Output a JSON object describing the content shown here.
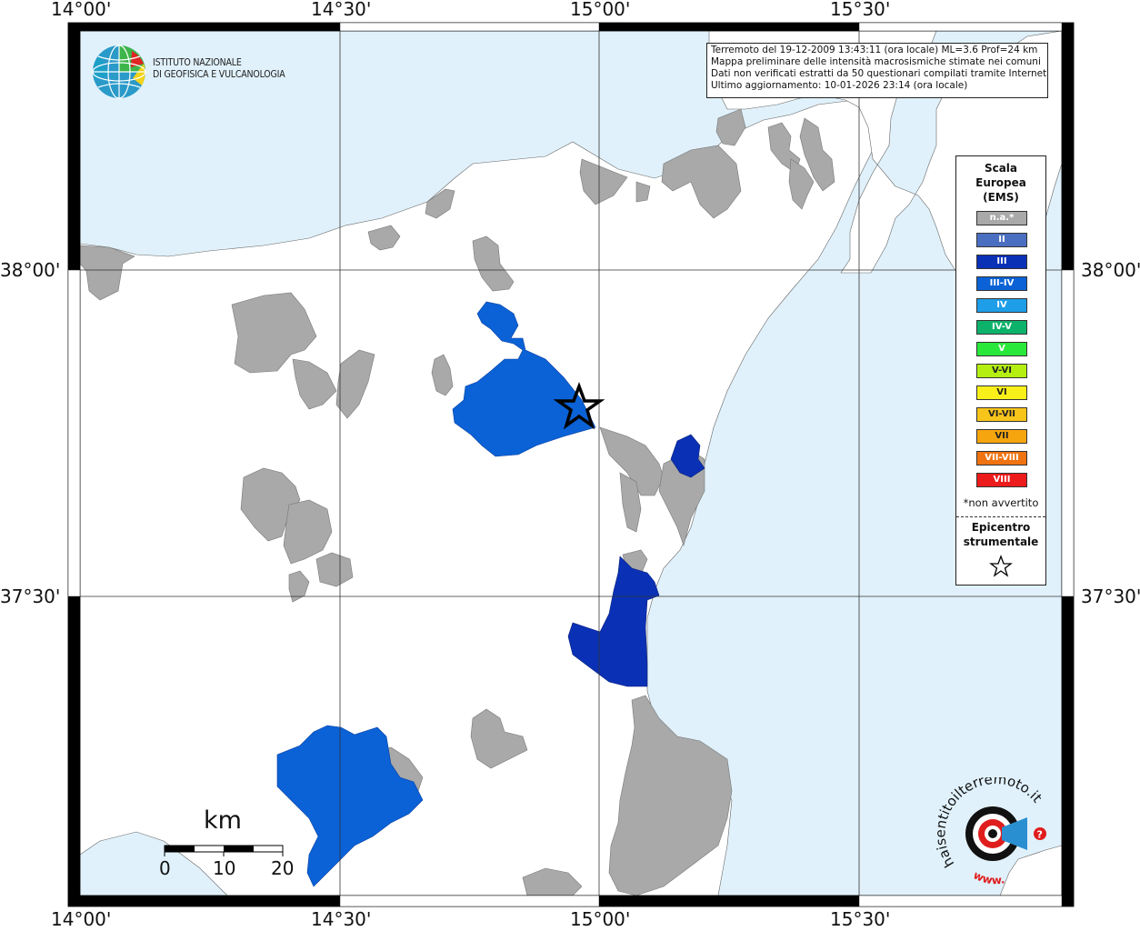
{
  "map": {
    "lon_ticks": [
      "14°00'",
      "14°30'",
      "15°00'",
      "15°30'"
    ],
    "lat_ticks": [
      "38°00'",
      "37°30'"
    ]
  },
  "info": {
    "line1": "Terremoto del 19-12-2009 13:43:11 (ora locale) ML=3.6 Prof=24 km",
    "line2": "Mappa preliminare delle intensità macrosismiche stimate nei comuni",
    "line3": "Dati non verificati estratti da 50 questionari compilati tramite Internet.",
    "line4": "Ultimo aggiornamento: 10-01-2026 23:14 (ora locale)"
  },
  "ingv": {
    "line1": "ISTITUTO NAZIONALE",
    "line2": "DI GEOFISICA E VULCANOLOGIA"
  },
  "legend": {
    "title1": "Scala",
    "title2": "Europea",
    "title3": "(EMS)",
    "items": [
      {
        "label": "n.a.*",
        "color": "#a9a9a9"
      },
      {
        "label": "II",
        "color": "#4a6fc0"
      },
      {
        "label": "III",
        "color": "#0a31b5"
      },
      {
        "label": "III-IV",
        "color": "#0a62d6"
      },
      {
        "label": "IV",
        "color": "#1e9ee8"
      },
      {
        "label": "IV-V",
        "color": "#0db26a"
      },
      {
        "label": "V",
        "color": "#29e83a"
      },
      {
        "label": "V-VI",
        "color": "#b5ef12"
      },
      {
        "label": "VI",
        "color": "#f9f01a"
      },
      {
        "label": "VI-VII",
        "color": "#f7c51a"
      },
      {
        "label": "VII",
        "color": "#f7a50f"
      },
      {
        "label": "VII-VIII",
        "color": "#ef7310"
      },
      {
        "label": "VIII",
        "color": "#ec1c1c"
      }
    ],
    "note": "*non avvertito",
    "epi1": "Epicentro",
    "epi2": "strumentale"
  },
  "scale": {
    "unit": "km",
    "labels": [
      "0",
      "10",
      "20"
    ]
  },
  "hsit": {
    "text": "haisentitoilterremoto.it",
    "www": "www."
  },
  "colors": {
    "sea": "#e0f1fb",
    "land": "#ffffff",
    "na": "#a9a9a9",
    "iii": "#0a31b5",
    "iii_iv": "#0a62d6"
  }
}
